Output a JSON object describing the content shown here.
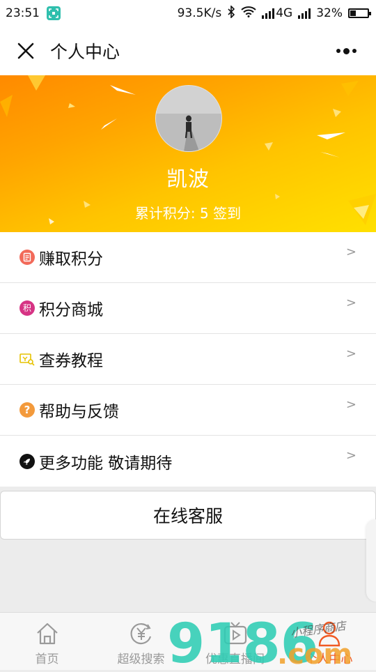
{
  "status_bar": {
    "time": "23:51",
    "net_speed": "93.5K/s",
    "network": "4G",
    "battery": "32%",
    "battery_level": 0.32
  },
  "header": {
    "title": "个人中心",
    "close_icon": "close-icon",
    "more_icon": "more-icon"
  },
  "profile": {
    "name": "凯波",
    "points_line": "累计积分: 5 签到"
  },
  "menu": [
    {
      "label": "赚取积分",
      "icon": "clipboard-icon",
      "color": "#f26a5a"
    },
    {
      "label": "积分商城",
      "icon": "points-mall-icon",
      "color": "#d63384"
    },
    {
      "label": "查券教程",
      "icon": "coupon-search-icon",
      "color": "#e6c200"
    },
    {
      "label": "帮助与反馈",
      "icon": "help-icon",
      "color": "#f39a3c"
    },
    {
      "label": "更多功能 敬请期待",
      "icon": "rocket-icon",
      "color": "#111111"
    }
  ],
  "chevron": ">",
  "service_button": "在线客服",
  "tabs": [
    {
      "label": "首页",
      "icon": "home-icon"
    },
    {
      "label": "超级搜索",
      "icon": "yen-search-icon"
    },
    {
      "label": "优惠直播间",
      "icon": "tv-play-icon"
    },
    {
      "label": "个人中心",
      "icon": "person-icon",
      "active": true
    }
  ],
  "watermark": {
    "text": "9186",
    "suffix": ".com",
    "script": "小程序商店"
  },
  "colors": {
    "accent": "#f05a24",
    "banner_start": "#ff8a00",
    "banner_end": "#ffe000"
  }
}
